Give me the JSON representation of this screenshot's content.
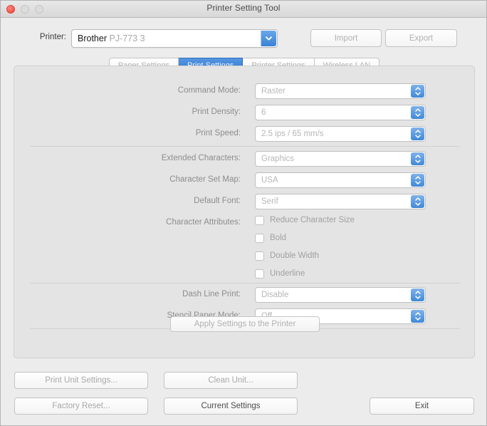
{
  "window": {
    "title": "Printer Setting Tool",
    "controls": {
      "close": "close-button",
      "minimize": "minimize-button",
      "zoom": "zoom-button"
    }
  },
  "printer_bar": {
    "label": "Printer:",
    "selected_brand": "Brother",
    "selected_model": "PJ-773 3",
    "import_label": "Import",
    "export_label": "Export"
  },
  "tabs": [
    {
      "label": "Paper Settings",
      "active": false
    },
    {
      "label": "Print Settings",
      "active": true
    },
    {
      "label": "Printer Settings",
      "active": false
    },
    {
      "label": "Wireless LAN",
      "active": false
    }
  ],
  "print_settings": {
    "group1": [
      {
        "label": "Command Mode:",
        "value": "Raster"
      },
      {
        "label": "Print Density:",
        "value": "6"
      },
      {
        "label": "Print Speed:",
        "value": "2.5 ips / 65 mm/s"
      }
    ],
    "group2": [
      {
        "label": "Extended Characters:",
        "value": "Graphics"
      },
      {
        "label": "Character Set Map:",
        "value": "USA"
      },
      {
        "label": "Default Font:",
        "value": "Serif"
      }
    ],
    "character_attributes": {
      "label": "Character Attributes:",
      "options": [
        {
          "label": "Reduce Character Size",
          "checked": false
        },
        {
          "label": "Bold",
          "checked": false
        },
        {
          "label": "Double Width",
          "checked": false
        },
        {
          "label": "Underline",
          "checked": false
        }
      ]
    },
    "group3": [
      {
        "label": "Dash Line Print:",
        "value": "Disable"
      },
      {
        "label": "Stencil Paper Mode:",
        "value": "Off"
      }
    ],
    "apply_label": "Apply Settings to the Printer"
  },
  "bottom_bar": {
    "print_unit_settings": "Print Unit Settings...",
    "clean_unit": "Clean Unit...",
    "factory_reset": "Factory Reset...",
    "current_settings": "Current Settings",
    "exit": "Exit"
  },
  "colors": {
    "accent_blue": "#3b82d6",
    "active_tab": "#2f77cf",
    "window_bg": "#ececec",
    "panel_bg": "#e4e4e4",
    "close_red": "#f05347"
  }
}
